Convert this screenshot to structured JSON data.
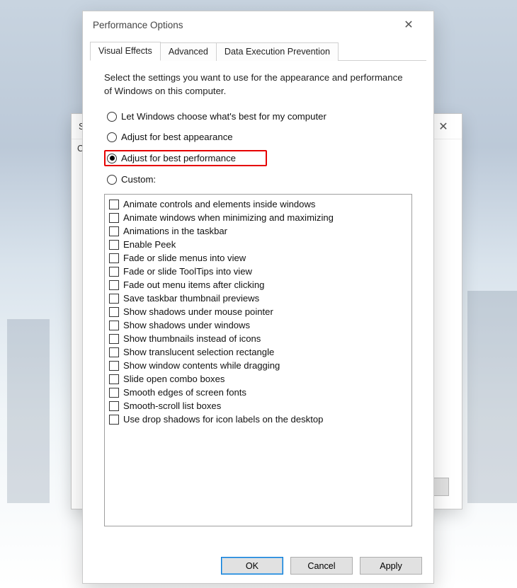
{
  "underlay": {
    "title_fragment": "Sy",
    "tab_fragment": "Co"
  },
  "dialog": {
    "title": "Performance Options",
    "tabs": [
      {
        "label": "Visual Effects",
        "active": true
      },
      {
        "label": "Advanced",
        "active": false
      },
      {
        "label": "Data Execution Prevention",
        "active": false
      }
    ],
    "instructions": "Select the settings you want to use for the appearance and performance of Windows on this computer.",
    "radios": [
      {
        "label": "Let Windows choose what's best for my computer",
        "selected": false
      },
      {
        "label": "Adjust for best appearance",
        "selected": false
      },
      {
        "label": "Adjust for best performance",
        "selected": true,
        "highlight": true
      },
      {
        "label": "Custom:",
        "selected": false
      }
    ],
    "checkboxes": [
      {
        "label": "Animate controls and elements inside windows",
        "checked": false
      },
      {
        "label": "Animate windows when minimizing and maximizing",
        "checked": false
      },
      {
        "label": "Animations in the taskbar",
        "checked": false
      },
      {
        "label": "Enable Peek",
        "checked": false
      },
      {
        "label": "Fade or slide menus into view",
        "checked": false
      },
      {
        "label": "Fade or slide ToolTips into view",
        "checked": false
      },
      {
        "label": "Fade out menu items after clicking",
        "checked": false
      },
      {
        "label": "Save taskbar thumbnail previews",
        "checked": false
      },
      {
        "label": "Show shadows under mouse pointer",
        "checked": false
      },
      {
        "label": "Show shadows under windows",
        "checked": false
      },
      {
        "label": "Show thumbnails instead of icons",
        "checked": false
      },
      {
        "label": "Show translucent selection rectangle",
        "checked": false
      },
      {
        "label": "Show window contents while dragging",
        "checked": false
      },
      {
        "label": "Slide open combo boxes",
        "checked": false
      },
      {
        "label": "Smooth edges of screen fonts",
        "checked": false
      },
      {
        "label": "Smooth-scroll list boxes",
        "checked": false
      },
      {
        "label": "Use drop shadows for icon labels on the desktop",
        "checked": false
      }
    ],
    "buttons": {
      "ok": "OK",
      "cancel": "Cancel",
      "apply": "Apply"
    }
  }
}
